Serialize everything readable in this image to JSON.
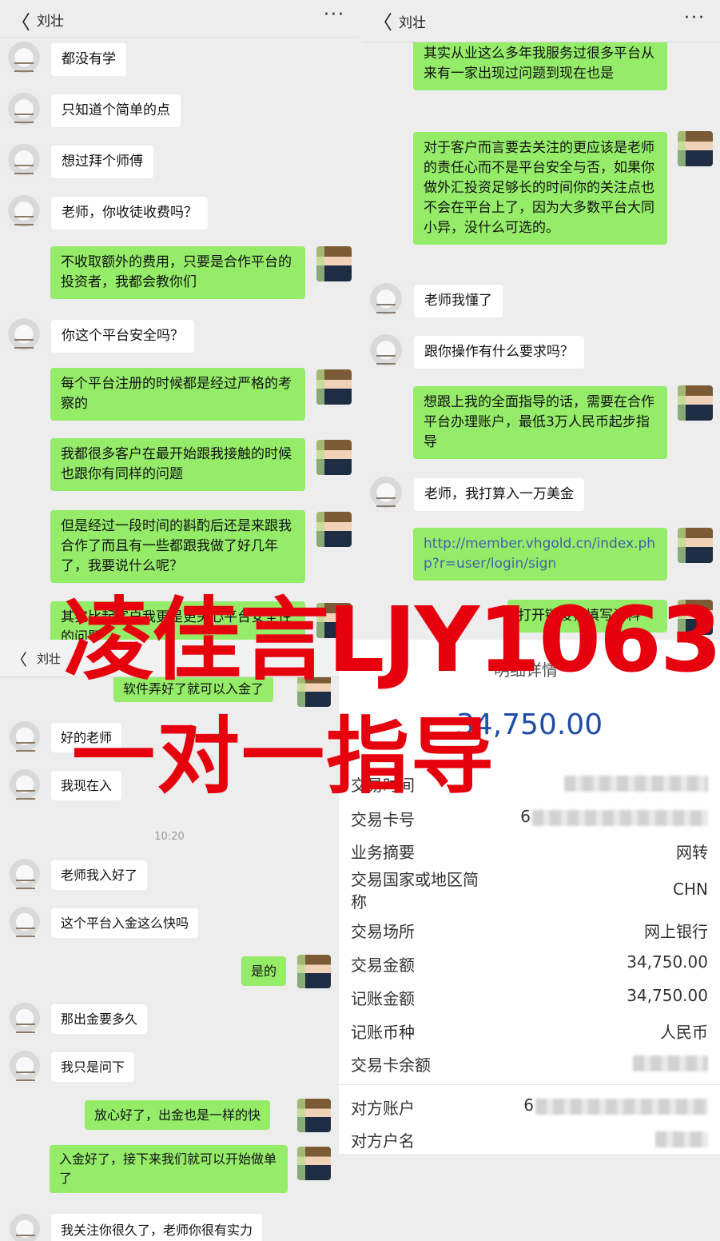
{
  "chat": {
    "contact_name": "刘壮",
    "back_glyph": "〈",
    "more_glyph": "···"
  },
  "panel1": {
    "messages": [
      {
        "from": "them",
        "text": "都没有学"
      },
      {
        "from": "them",
        "text": "只知道个简单的点"
      },
      {
        "from": "them",
        "text": "想过拜个师傅"
      },
      {
        "from": "them",
        "text": "老师，你收徒收费吗？"
      },
      {
        "from": "me",
        "text": "不收取额外的费用，只要是合作平台的投资者，我都会教你们"
      },
      {
        "from": "them",
        "text": "你这个平台安全吗？"
      },
      {
        "from": "me",
        "text": "每个平台注册的时候都是经过严格的考察的"
      },
      {
        "from": "me",
        "text": "我都很多客户在最开始跟我接触的时候也跟你有同样的问题"
      },
      {
        "from": "me",
        "text": "但是经过一段时间的斟酌后还是来跟我合作了而且有一些都跟我做了好几年了，我要说什么呢？"
      },
      {
        "from": "me",
        "text": "其实比起客户我更是更关心平台安全性的问题"
      }
    ]
  },
  "panel2": {
    "messages": [
      {
        "from": "me",
        "text": "时间越影响到我的客户无法盈利，但是其实从业这么多年我服务过很多平台从来有一家出现过问题到现在也是"
      },
      {
        "from": "me",
        "text": "对于客户而言要去关注的更应该是老师的责任心而不是平台安全与否，如果你做外汇投资足够长的时间你的关注点也不会在平台上了，因为大多数平台大同小异，没什么可选的。"
      },
      {
        "from": "them",
        "text": "老师我懂了"
      },
      {
        "from": "them",
        "text": "跟你操作有什么要求吗？"
      },
      {
        "from": "me",
        "text": "想跟上我的全面指导的话，需要在合作平台办理账户，最低3万人民币起步指导"
      },
      {
        "from": "them",
        "text": "老师，我打算入一万美金"
      },
      {
        "from": "me",
        "text": "http://member.vhgold.cn/index.php?r=user/login/sign",
        "link": true
      },
      {
        "from": "me",
        "text": "打开链接，填写资料"
      }
    ]
  },
  "panel3": {
    "timestamp": "10:20",
    "messages": [
      {
        "from": "me",
        "text": "软件弄好了就可以入金了"
      },
      {
        "from": "them",
        "text": "好的老师"
      },
      {
        "from": "them",
        "text": "我现在入"
      },
      {
        "from": "them",
        "text": "老师我入好了"
      },
      {
        "from": "them",
        "text": "这个平台入金这么快吗"
      },
      {
        "from": "me",
        "text": "是的"
      },
      {
        "from": "them",
        "text": "那出金要多久"
      },
      {
        "from": "them",
        "text": "我只是问下"
      },
      {
        "from": "me",
        "text": "放心好了，出金也是一样的快"
      },
      {
        "from": "me",
        "text": "入金好了，接下来我们就可以开始做单了"
      },
      {
        "from": "them",
        "text": "我关注你很久了，老师你很有实力"
      }
    ]
  },
  "bank": {
    "title": "明细详情",
    "amount": "34,750.00",
    "rows": [
      {
        "label": "交易时间",
        "value": "",
        "blurred": true
      },
      {
        "label": "交易卡号",
        "value": "6",
        "blurred": true
      },
      {
        "label": "业务摘要",
        "value": "网转"
      },
      {
        "label": "交易国家或地区简称",
        "value": "CHN"
      },
      {
        "label": "交易场所",
        "value": "网上银行"
      },
      {
        "label": "交易金额",
        "value": "34,750.00"
      },
      {
        "label": "记账金额",
        "value": "34,750.00"
      },
      {
        "label": "记账币种",
        "value": "人民币"
      },
      {
        "label": "交易卡余额",
        "value": "",
        "blurred": true
      },
      {
        "label": "对方账户",
        "value": "6",
        "blurred": true
      },
      {
        "label": "对方户名",
        "value": "",
        "blurred": true
      }
    ]
  },
  "watermark": {
    "line1": "凌佳言LJY1063",
    "line2": "一对一指导",
    "color": "#e6000d"
  },
  "colors": {
    "my_bubble": "#95ec69",
    "their_bubble": "#ffffff",
    "chat_bg": "#ededed",
    "link": "#4361a8"
  }
}
